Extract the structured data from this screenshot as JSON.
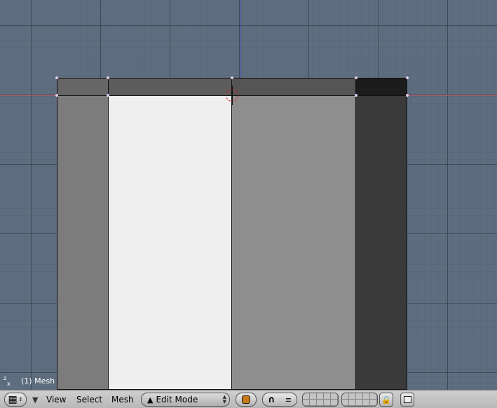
{
  "viewport": {
    "object_label": "(1) Mesh",
    "gizmo_z": "z",
    "gizmo_x": "x"
  },
  "header": {
    "menus": [
      "View",
      "Select",
      "Mesh"
    ],
    "mode": "Edit Mode",
    "icons": [
      "grid-icon",
      "triangle-down-icon",
      "edit-mode-icon",
      "shading-icon",
      "magnet-icon",
      "snap-icon",
      "lock-icon",
      "render-icon"
    ]
  },
  "colors": {
    "viewport_bg": "#5e6d7f",
    "face_light": "#efefef",
    "face_mid": "#8e8e8e",
    "face_left": "#7c7c7c",
    "face_dark": "#3a3a3a",
    "face_darkest": "#1c1c1c",
    "header_bg": "#c4c4c4"
  }
}
